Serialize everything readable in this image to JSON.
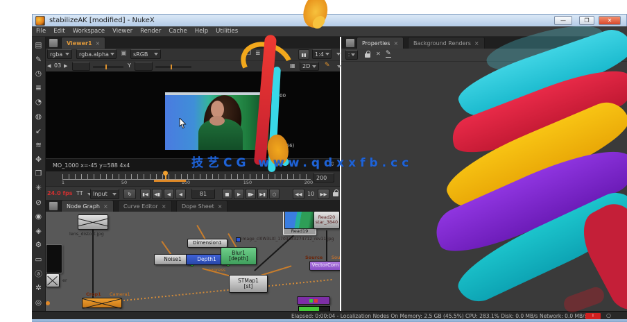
{
  "window": {
    "title": "stabilizeAK [modified] - NukeX",
    "minimize": "—",
    "maximize": "❐",
    "close": "✕"
  },
  "menu": {
    "items": [
      "File",
      "Edit",
      "Workspace",
      "Viewer",
      "Render",
      "Cache",
      "Help",
      "Utilities"
    ]
  },
  "ui": {
    "close": "×"
  },
  "left_toolbar": {
    "icons": [
      {
        "name": "image",
        "glyph": "▤"
      },
      {
        "name": "draw",
        "glyph": "✎"
      },
      {
        "name": "time",
        "glyph": "◷"
      },
      {
        "name": "channel",
        "glyph": "≣"
      },
      {
        "name": "color",
        "glyph": "◔"
      },
      {
        "name": "filter",
        "glyph": "◍"
      },
      {
        "name": "keyer",
        "glyph": "↙"
      },
      {
        "name": "merge",
        "glyph": "≋"
      },
      {
        "name": "transform",
        "glyph": "✥"
      },
      {
        "name": "3d",
        "glyph": "❒"
      },
      {
        "name": "particles",
        "glyph": "✳"
      },
      {
        "name": "deep",
        "glyph": "⊘"
      },
      {
        "name": "views",
        "glyph": "◉"
      },
      {
        "name": "metadata",
        "glyph": "◈"
      },
      {
        "name": "toolsets",
        "glyph": "⚙"
      },
      {
        "name": "other",
        "glyph": "▭"
      },
      {
        "name": "plugins",
        "glyph": "ⓐ"
      },
      {
        "name": "sparkles",
        "glyph": "✲"
      },
      {
        "name": "render",
        "glyph": "◎"
      }
    ]
  },
  "viewer": {
    "tab": "Viewer1",
    "layer": "rgba",
    "channel": "rgba.alpha",
    "lut": "sRGB",
    "wipe": "❐",
    "stack": "≣",
    "pause": "▮▮",
    "zoom_ratio": "1:4",
    "frame_back": "◀",
    "frame_num": "03",
    "frame_fwd": "▶",
    "axis": "Y",
    "roi": "▦",
    "view_mode": "2D",
    "pencil": "✎",
    "overlay_range": ".1000",
    "overlay_res": "(608x256)",
    "coord_readout": "MO_1000   x=-45  y=588   4x4"
  },
  "timeline": {
    "ticks": [
      "1",
      "50",
      "100",
      "150",
      "200"
    ],
    "range_end": "200",
    "fps": "24.0 fps",
    "mode": "TT",
    "input": "Input",
    "frame": "81",
    "step": "10",
    "buttons": {
      "loop": "↻",
      "first": "▮◀",
      "prev_key": "◀▮",
      "play_back": "◀",
      "step_back": "◀",
      "stop": "■",
      "play": "▶",
      "step_fwd": "▮▶",
      "last": "▶▮",
      "cycle": "○",
      "jump_back": "◀◀",
      "jump_fwd": "▶▶"
    }
  },
  "node_graph": {
    "tabs": [
      "Node Graph",
      "Curve Editor",
      "Dope Sheet"
    ],
    "nodes": {
      "lens": {
        "label": "lens_distort.jpg"
      },
      "viewer_read": {
        "label": "er"
      },
      "noise": {
        "label": "Noise1"
      },
      "dimension": {
        "label": "Dimension1"
      },
      "depth": {
        "label": "Depth1"
      },
      "blur": {
        "line1": "Blur1",
        "line2": "[depth]"
      },
      "stmap": {
        "line1": "STMap1",
        "line2": "[st]"
      },
      "read19": {
        "label": "Read19",
        "file": "image_cl0W3LXl_1703333274712_rev11.jpg"
      },
      "read20": {
        "line1": "Read20",
        "line2": "star_3840"
      },
      "vector": {
        "label": "VectorCorn",
        "src1": "Source",
        "src2": "Sour"
      },
      "crop": {
        "label1": "Crop1",
        "label2": "Camera1"
      },
      "expr_label": "express"
    }
  },
  "properties": {
    "tabs": [
      "Properties",
      "Background Renders"
    ]
  },
  "status_bar": {
    "text": "Elapsed: 0:00:04 -  Localization Nodes On   Memory: 2.5 GB (45.5%)   CPU: 283.1%   Disk: 0.0 MB/s   Network: 0.0 MB/s",
    "alert": "!",
    "spinner": "○"
  },
  "watermark": "技艺CG  www.qdxxfb.cc",
  "colors": {
    "accent_orange": "#e8952f",
    "tab_text": "#e39b3b",
    "playhead": "#f0a030",
    "fps_red": "#d03030",
    "paint_cyan": "#25c8dd",
    "paint_red": "#de2440",
    "paint_yellow": "#f5b80e",
    "paint_purple": "#8326d8",
    "paint_teal": "#14b4bc",
    "watermark_blue": "#1f63d6"
  }
}
